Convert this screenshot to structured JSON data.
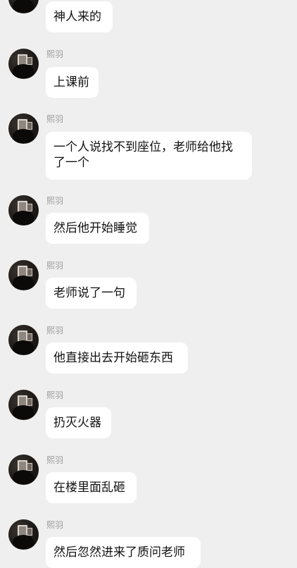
{
  "messages": [
    {
      "name": "",
      "text": "神人来的"
    },
    {
      "name": "熙羽",
      "text": "上课前"
    },
    {
      "name": "熙羽",
      "text": "一个人说找不到座位，老师给他找了一个"
    },
    {
      "name": "熙羽",
      "text": "然后他开始睡觉"
    },
    {
      "name": "熙羽",
      "text": "老师说了一句"
    },
    {
      "name": "熙羽",
      "text": "他直接出去开始砸东西"
    },
    {
      "name": "熙羽",
      "text": "扔灭火器"
    },
    {
      "name": "熙羽",
      "text": "在楼里面乱砸"
    },
    {
      "name": "熙羽",
      "text": "然后忽然进来了质问老师"
    }
  ]
}
